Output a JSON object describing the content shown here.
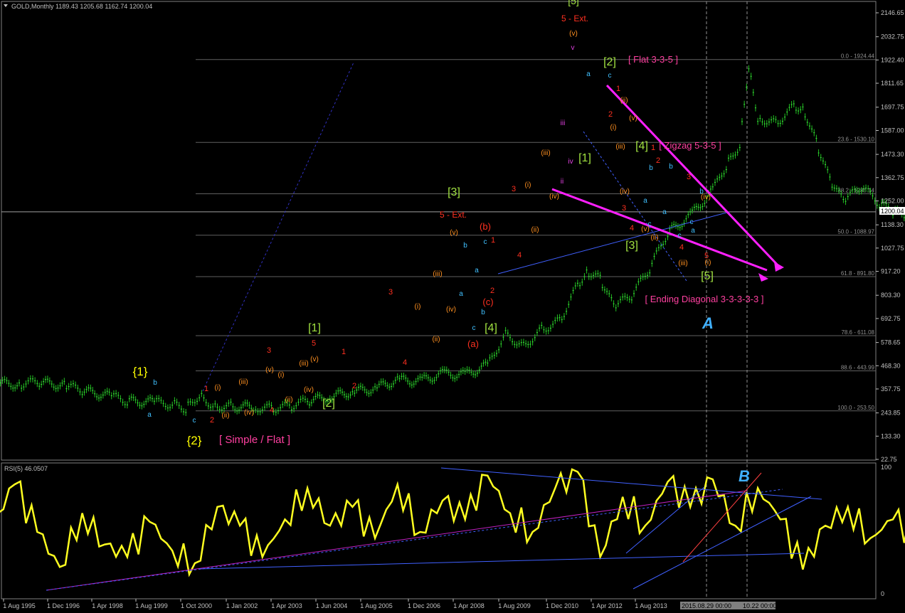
{
  "main": {
    "header": "GOLD,Monthly  1189.43 1205.68 1162.74 1200.04",
    "price_badge": "1200.04",
    "y_ticks": [
      "2146.65",
      "2032.75",
      "1922.40",
      "1811.65",
      "1697.75",
      "1587.00",
      "1473.30",
      "1362.75",
      "1252.00",
      "1138.30",
      "1027.75",
      "917.20",
      "803.30",
      "692.75",
      "578.65",
      "468.30",
      "357.75",
      "243.85",
      "133.30",
      "22.75"
    ],
    "fib_levels": [
      {
        "label": "0.0 - 1924.44",
        "price": 1924.44
      },
      {
        "label": "23.6 - 1530.10",
        "price": 1530.1
      },
      {
        "label": "38.2 - 1286.14",
        "price": 1286.14
      },
      {
        "label": "50.0 - 1088.97",
        "price": 1088.97
      },
      {
        "label": "61.8 - 891.80",
        "price": 891.8
      },
      {
        "label": "78.6 - 611.08",
        "price": 611.08
      },
      {
        "label": "88.6 - 443.99",
        "price": 443.99
      },
      {
        "label": "100.0 - 253.50",
        "price": 253.5
      }
    ]
  },
  "rsi": {
    "header": "RSI(5) 46.0507",
    "top_tick": "100",
    "bottom_tick": "0"
  },
  "x_axis": {
    "ticks": [
      "1 Aug 1995",
      "1 Dec 1996",
      "1 Apr 1998",
      "1 Aug 1999",
      "1 Oct 2000",
      "1 Jan 2002",
      "1 Apr 2003",
      "1 Jun 2004",
      "1 Aug 2005",
      "1 Dec 2006",
      "1 Apr 2008",
      "1 Aug 2009",
      "1 Dec 2010",
      "1 Apr 2012",
      "1 Aug 2013"
    ],
    "highlight_1": "2015.08.29 00:00",
    "highlight_2": "10.22 00:00"
  },
  "annotations": [
    {
      "t": "{1}",
      "c": "#ffff00",
      "s": 17
    },
    {
      "t": "b",
      "c": "#40c0ff",
      "s": 10
    },
    {
      "t": "a",
      "c": "#40c0ff",
      "s": 10
    },
    {
      "t": "c",
      "c": "#40c0ff",
      "s": 10
    },
    {
      "t": "{2}",
      "c": "#ffff00",
      "s": 17
    },
    {
      "t": "[ Simple / Flat ]",
      "c": "#ff40a0",
      "s": 15
    },
    {
      "t": "[1]",
      "c": "#a0e040",
      "s": 16
    },
    {
      "t": "[2]",
      "c": "#a0e040",
      "s": 16
    },
    {
      "t": "[3]",
      "c": "#a0e040",
      "s": 16
    },
    {
      "t": "[4]",
      "c": "#a0e040",
      "s": 16
    },
    {
      "t": "[1]",
      "c": "#a0e040",
      "s": 16
    },
    {
      "t": "[2]",
      "c": "#a0e040",
      "s": 16
    },
    {
      "t": "[3]",
      "c": "#a0e040",
      "s": 16
    },
    {
      "t": "[4]",
      "c": "#a0e040",
      "s": 16
    },
    {
      "t": "[5]",
      "c": "#a0e040",
      "s": 16
    },
    {
      "t": "[5]",
      "c": "#a0e040",
      "s": 14
    },
    {
      "t": "5 - Ext.",
      "c": "#ff3020",
      "s": 12
    },
    {
      "t": "5 - Ext.",
      "c": "#ff3020",
      "s": 12
    },
    {
      "t": "[ Flat 3-3-5 ]",
      "c": "#ff40a0",
      "s": 13
    },
    {
      "t": "[ Zigzag 5-3-5 ]",
      "c": "#ff40a0",
      "s": 13
    },
    {
      "t": "[ Ending Diagonal 3-3-3-3-3 ]",
      "c": "#ff40a0",
      "s": 13
    },
    {
      "t": "(a)",
      "c": "#ff3020",
      "s": 13
    },
    {
      "t": "(b)",
      "c": "#ff3020",
      "s": 13
    },
    {
      "t": "(c)",
      "c": "#ff3020",
      "s": 13
    },
    {
      "t": "1",
      "c": "#ff3020",
      "s": 11
    },
    {
      "t": "2",
      "c": "#ff3020",
      "s": 11
    },
    {
      "t": "3",
      "c": "#ff3020",
      "s": 11
    },
    {
      "t": "4",
      "c": "#ff3020",
      "s": 11
    },
    {
      "t": "5",
      "c": "#ff3020",
      "s": 11
    },
    {
      "t": "1",
      "c": "#ff3020",
      "s": 11
    },
    {
      "t": "2",
      "c": "#ff3020",
      "s": 11
    },
    {
      "t": "3",
      "c": "#ff3020",
      "s": 11
    },
    {
      "t": "4",
      "c": "#ff3020",
      "s": 11
    },
    {
      "t": "1",
      "c": "#ff3020",
      "s": 11
    },
    {
      "t": "2",
      "c": "#ff3020",
      "s": 11
    },
    {
      "t": "3",
      "c": "#ff3020",
      "s": 11
    },
    {
      "t": "4",
      "c": "#ff3020",
      "s": 11
    },
    {
      "t": "1",
      "c": "#ff3020",
      "s": 11
    },
    {
      "t": "2",
      "c": "#ff3020",
      "s": 11
    },
    {
      "t": "3",
      "c": "#ff3020",
      "s": 11
    },
    {
      "t": "4",
      "c": "#ff3020",
      "s": 11
    },
    {
      "t": "1",
      "c": "#ff3020",
      "s": 11
    },
    {
      "t": "2",
      "c": "#ff3020",
      "s": 11
    },
    {
      "t": "3",
      "c": "#ff3020",
      "s": 11
    },
    {
      "t": "4",
      "c": "#ff3020",
      "s": 11
    },
    {
      "t": "5",
      "c": "#ff3020",
      "s": 11
    },
    {
      "t": "(i)",
      "c": "#ff9020",
      "s": 10
    },
    {
      "t": "(ii)",
      "c": "#ff9020",
      "s": 10
    },
    {
      "t": "(iii)",
      "c": "#ff9020",
      "s": 10
    },
    {
      "t": "(iv)",
      "c": "#ff9020",
      "s": 10
    },
    {
      "t": "(v)",
      "c": "#ff9020",
      "s": 10
    },
    {
      "t": "(i)",
      "c": "#ff9020",
      "s": 10
    },
    {
      "t": "(ii)",
      "c": "#ff9020",
      "s": 10
    },
    {
      "t": "(iii)",
      "c": "#ff9020",
      "s": 10
    },
    {
      "t": "(iv)",
      "c": "#ff9020",
      "s": 10
    },
    {
      "t": "(v)",
      "c": "#ff9020",
      "s": 10
    },
    {
      "t": "(i)",
      "c": "#ff9020",
      "s": 10
    },
    {
      "t": "(ii)",
      "c": "#ff9020",
      "s": 10
    },
    {
      "t": "(iii)",
      "c": "#ff9020",
      "s": 10
    },
    {
      "t": "(iv)",
      "c": "#ff9020",
      "s": 10
    },
    {
      "t": "(v)",
      "c": "#ff9020",
      "s": 10
    },
    {
      "t": "(i)",
      "c": "#ff9020",
      "s": 10
    },
    {
      "t": "(ii)",
      "c": "#ff9020",
      "s": 10
    },
    {
      "t": "(iii)",
      "c": "#ff9020",
      "s": 10
    },
    {
      "t": "(iv)",
      "c": "#ff9020",
      "s": 10
    },
    {
      "t": "(v)",
      "c": "#ff9020",
      "s": 10
    },
    {
      "t": "(i)",
      "c": "#ff9020",
      "s": 10
    },
    {
      "t": "(ii)",
      "c": "#ff9020",
      "s": 10
    },
    {
      "t": "(iii)",
      "c": "#ff9020",
      "s": 10
    },
    {
      "t": "(iv)",
      "c": "#ff9020",
      "s": 10
    },
    {
      "t": "(v)",
      "c": "#ff9020",
      "s": 10
    },
    {
      "t": "(i)",
      "c": "#ff9020",
      "s": 10
    },
    {
      "t": "(ii)",
      "c": "#ff9020",
      "s": 10
    },
    {
      "t": "(iii)",
      "c": "#ff9020",
      "s": 10
    },
    {
      "t": "(iv)",
      "c": "#ff9020",
      "s": 10
    },
    {
      "t": "(v)",
      "c": "#ff9020",
      "s": 10
    },
    {
      "t": "ii",
      "c": "#e040e0",
      "s": 10
    },
    {
      "t": "iii",
      "c": "#e040e0",
      "s": 10
    },
    {
      "t": "iv",
      "c": "#e040e0",
      "s": 10
    },
    {
      "t": "v",
      "c": "#e040e0",
      "s": 10
    },
    {
      "t": "a",
      "c": "#40c0ff",
      "s": 10
    },
    {
      "t": "b",
      "c": "#40c0ff",
      "s": 10
    },
    {
      "t": "c",
      "c": "#40c0ff",
      "s": 10
    },
    {
      "t": "a",
      "c": "#40c0ff",
      "s": 10
    },
    {
      "t": "b",
      "c": "#40c0ff",
      "s": 10
    },
    {
      "t": "c",
      "c": "#40c0ff",
      "s": 10
    },
    {
      "t": "a",
      "c": "#40c0ff",
      "s": 10
    },
    {
      "t": "c",
      "c": "#40c0ff",
      "s": 10
    },
    {
      "t": "a",
      "c": "#40c0ff",
      "s": 10
    },
    {
      "t": "b",
      "c": "#40c0ff",
      "s": 10
    },
    {
      "t": "c",
      "c": "#40c0ff",
      "s": 10
    },
    {
      "t": "a",
      "c": "#40c0ff",
      "s": 10
    },
    {
      "t": "b",
      "c": "#40c0ff",
      "s": 10
    },
    {
      "t": "c",
      "c": "#40c0ff",
      "s": 10
    },
    {
      "t": "a",
      "c": "#40c0ff",
      "s": 10
    },
    {
      "t": "b",
      "c": "#40c0ff",
      "s": 10
    },
    {
      "t": "c",
      "c": "#40c0ff",
      "s": 10
    },
    {
      "t": "A",
      "c": "#40b0ff",
      "s": 22
    },
    {
      "t": "B",
      "c": "#40b0ff",
      "s": 22
    }
  ],
  "chart_data": {
    "type": "line",
    "title": "GOLD,Monthly",
    "x_tick_labels": [
      "1 Aug 1995",
      "1 Dec 1996",
      "1 Apr 1998",
      "1 Aug 1999",
      "1 Oct 2000",
      "1 Jan 2002",
      "1 Apr 2003",
      "1 Jun 2004",
      "1 Aug 2005",
      "1 Dec 2006",
      "1 Apr 2008",
      "1 Aug 2009",
      "1 Dec 2010",
      "1 Apr 2012",
      "1 Aug 2013"
    ],
    "ylim": [
      22.75,
      2146.65
    ],
    "ohlc_current": {
      "open": 1189.43,
      "high": 1205.68,
      "low": 1162.74,
      "close": 1200.04
    },
    "series": [
      {
        "name": "GOLD,Monthly",
        "x": [
          1995.0,
          1995.6,
          1996.0,
          1996.6,
          1997.0,
          1997.6,
          1998.0,
          1998.6,
          1999.0,
          1999.3,
          1999.6,
          1999.9,
          2000.3,
          2000.8,
          2001.2,
          2001.6,
          2002.0,
          2002.5,
          2003.0,
          2003.5,
          2004.0,
          2004.5,
          2005.0,
          2005.5,
          2006.0,
          2006.4,
          2006.8,
          2007.2,
          2007.6,
          2008.0,
          2008.2,
          2008.5,
          2008.8,
          2009.2,
          2009.6,
          2010.0,
          2010.5,
          2011.0,
          2011.3,
          2011.6,
          2011.8,
          2012.0,
          2012.4,
          2012.8,
          2013.0,
          2013.3,
          2013.6,
          2013.9,
          2014.3,
          2014.7,
          2015.0,
          2015.3,
          2015.6
        ],
        "y": [
          385,
          380,
          390,
          375,
          350,
          325,
          300,
          295,
          285,
          265,
          330,
          280,
          275,
          270,
          265,
          275,
          300,
          320,
          345,
          360,
          400,
          395,
          430,
          425,
          470,
          620,
          560,
          640,
          680,
          850,
          920,
          880,
          750,
          800,
          930,
          1100,
          1180,
          1300,
          1420,
          1520,
          1900,
          1650,
          1620,
          1700,
          1700,
          1530,
          1350,
          1250,
          1320,
          1240,
          1200,
          1180,
          1200
        ]
      },
      {
        "name": "RSI(5)",
        "x": [
          1995.0,
          1995.5,
          1996.0,
          1996.5,
          1997.0,
          1997.5,
          1998.0,
          1998.5,
          1999.0,
          1999.5,
          2000.0,
          2000.5,
          2001.0,
          2001.5,
          2002.0,
          2002.5,
          2003.0,
          2003.5,
          2004.0,
          2004.5,
          2005.0,
          2005.5,
          2006.0,
          2006.5,
          2007.0,
          2007.5,
          2008.0,
          2008.5,
          2009.0,
          2009.5,
          2010.0,
          2010.5,
          2011.0,
          2011.5,
          2012.0,
          2012.5,
          2013.0,
          2013.5,
          2014.0,
          2014.5,
          2015.0,
          2015.5
        ],
        "y": [
          55,
          88,
          50,
          22,
          65,
          40,
          30,
          58,
          35,
          25,
          70,
          55,
          30,
          60,
          85,
          55,
          70,
          45,
          88,
          50,
          75,
          60,
          95,
          65,
          50,
          85,
          98,
          30,
          78,
          55,
          90,
          70,
          92,
          55,
          85,
          60,
          20,
          55,
          70,
          45,
          60,
          46
        ]
      }
    ]
  }
}
